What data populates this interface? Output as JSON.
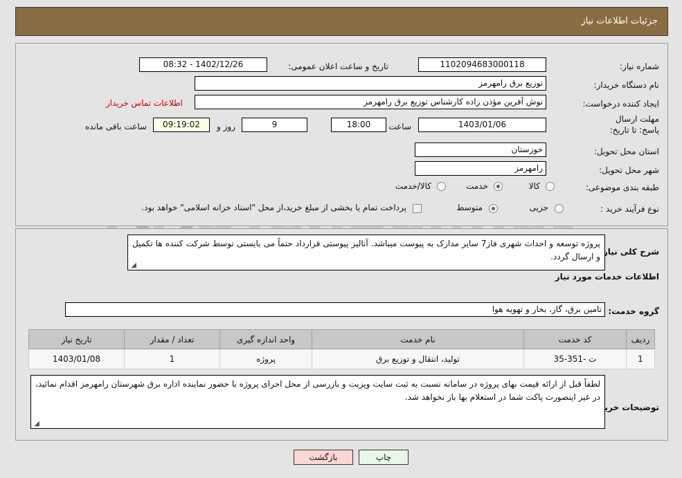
{
  "header": {
    "title": "جزئیات اطلاعات نیاز",
    "bar_color": "#8a6c43"
  },
  "watermark": {
    "text": "AriaTender.net"
  },
  "form": {
    "need_number_label": "شماره نیاز:",
    "need_number_value": "1102094683000118",
    "announce_datetime_label": "تاریخ و ساعت اعلان عمومی:",
    "announce_datetime_value": "1402/12/26 - 08:32",
    "buyer_org_label": "نام دستگاه خریدار:",
    "buyer_org_value": "توزیع برق رامهرمز",
    "requester_label": "ایجاد کننده درخواست:",
    "requester_value": "نوش آفرین مؤذن زاده کارشناس توزیع برق رامهرمز",
    "contact_link": "اطلاعات تماس خریدار",
    "deadline_label": "مهلت ارسال پاسخ: تا تاریخ:",
    "deadline_date": "1403/01/06",
    "deadline_hour_label": "ساعت",
    "deadline_hour_value": "18:00",
    "remaining_days_value": "9",
    "remaining_days_label": "روز و",
    "remaining_time_value": "09:19:02",
    "remaining_time_label": "ساعت باقی مانده",
    "province_label": "استان محل تحویل:",
    "province_value": "خوزستان",
    "city_label": "شهر محل تحویل:",
    "city_value": "رامهرمز",
    "category_label": "طبقه بندی موضوعی:",
    "category_options": [
      {
        "label": "کالا",
        "selected": false
      },
      {
        "label": "خدمت",
        "selected": true
      },
      {
        "label": "کالا/خدمت",
        "selected": false
      }
    ],
    "purchase_type_label": "نوع فرآیند خرید :",
    "purchase_type_options": [
      {
        "label": "جزیی",
        "selected": false
      },
      {
        "label": "متوسط",
        "selected": true
      }
    ],
    "treasury_checkbox_label": "پرداخت تمام یا بخشی از مبلغ خرید،از محل \"اسناد خزانه اسلامی\" خواهد بود.",
    "treasury_checked": false
  },
  "description": {
    "label": "شرح کلی نیاز:",
    "value": "پروژه توسعه و احداث شهری فاز7 سایر مدارک به پیوست میباشد. آنالیز پیوستی قرارداد حتماً می بایستی توسط شرکت کننده ها تکمیل و ارسال گردد."
  },
  "services_section": {
    "heading": "اطلاعات خدمات مورد نیاز",
    "group_label": "گروه خدمت:",
    "group_value": "تامین برق، گاز، بخار و تهویه هوا",
    "table": {
      "columns": [
        "ردیف",
        "کد خدمت",
        "نام خدمت",
        "واحد اندازه گیری",
        "تعداد / مقدار",
        "تاریخ نیاز"
      ],
      "rows": [
        {
          "row_no": "1",
          "service_code": "ت -351-35",
          "service_name": "تولید، انتقال و توزیع برق",
          "unit": "پروژه",
          "quantity": "1",
          "need_date": "1403/01/08"
        }
      ]
    }
  },
  "buyer_notes": {
    "label": "توضیحات خریدار:",
    "value": "لطفاً قبل از ارائه قیمت بهای پروژه در سامانه نسبت به ثبت سایت ویزیت و بازرسی از محل اجرای پروژه با حضور نماینده اداره برق شهرستان رامهرمز اقدام نمائید، در غیر اینصورت پاکت شما در استعلام بها باز نخواهد شد."
  },
  "footer": {
    "print_label": "چاپ",
    "back_label": "بازگشت"
  }
}
